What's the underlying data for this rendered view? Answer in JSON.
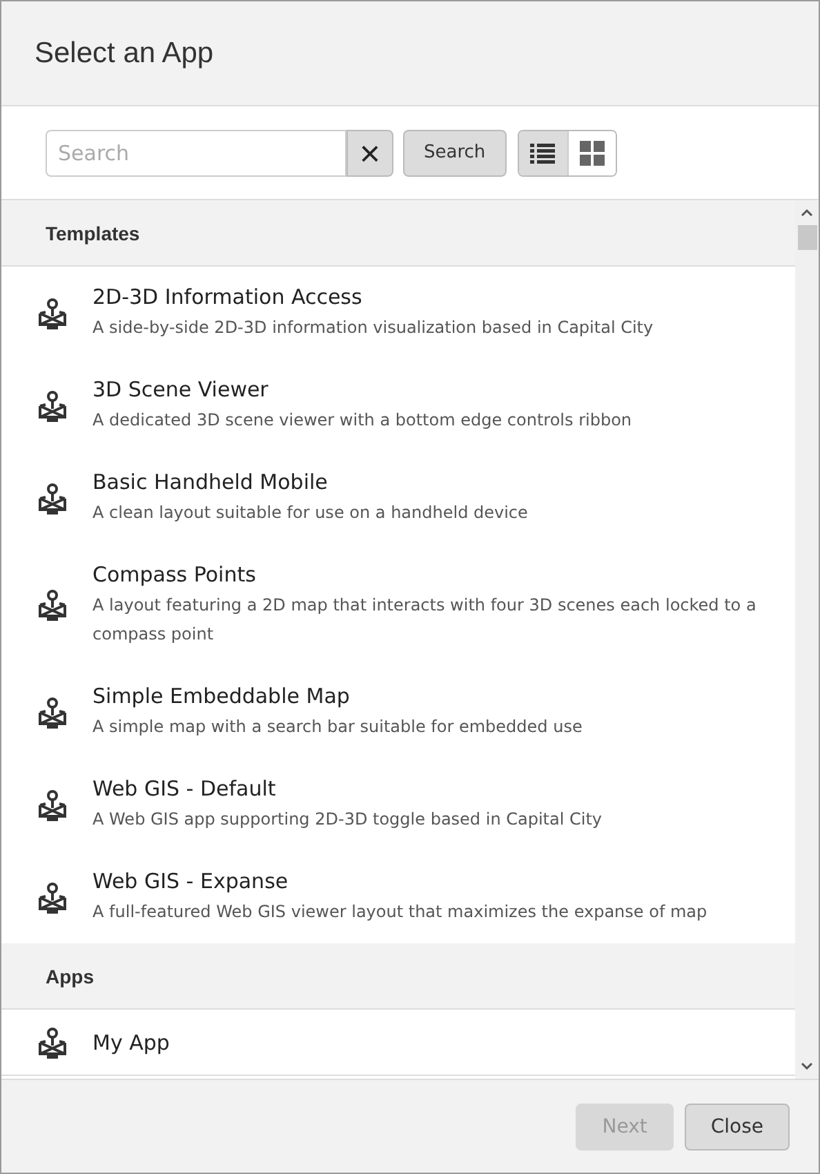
{
  "dialog": {
    "title": "Select an App"
  },
  "search": {
    "placeholder": "Search",
    "clear": "×",
    "button": "Search"
  },
  "view_buttons": [
    {
      "kind": "list",
      "selected": true
    },
    {
      "kind": "grid",
      "selected": false
    }
  ],
  "sections": [
    {
      "title": "Templates",
      "items": [
        {
          "name": "2D-3D Information Access",
          "description": "A side-by-side 2D-3D information visualization based in Capital City"
        },
        {
          "name": "3D Scene Viewer",
          "description": "A dedicated 3D scene viewer with a bottom edge controls ribbon"
        },
        {
          "name": "Basic Handheld Mobile",
          "description": "A clean layout suitable for use on a handheld device"
        },
        {
          "name": "Compass Points",
          "description": "A layout featuring a 2D map that interacts with four 3D scenes each locked to a compass point"
        },
        {
          "name": "Simple Embeddable Map",
          "description": "A simple map with a search bar suitable for embedded use"
        },
        {
          "name": "Web GIS - Default",
          "description": "A Web GIS app supporting 2D-3D toggle based in Capital City"
        },
        {
          "name": "Web GIS - Expanse",
          "description": "A full-featured Web GIS viewer layout that maximizes the expanse of map"
        }
      ]
    },
    {
      "title": "Apps",
      "items": [
        {
          "name": "My App"
        }
      ]
    }
  ],
  "footer": [
    {
      "label": "Next",
      "disabled": true
    },
    {
      "label": "Close",
      "disabled": false
    }
  ]
}
